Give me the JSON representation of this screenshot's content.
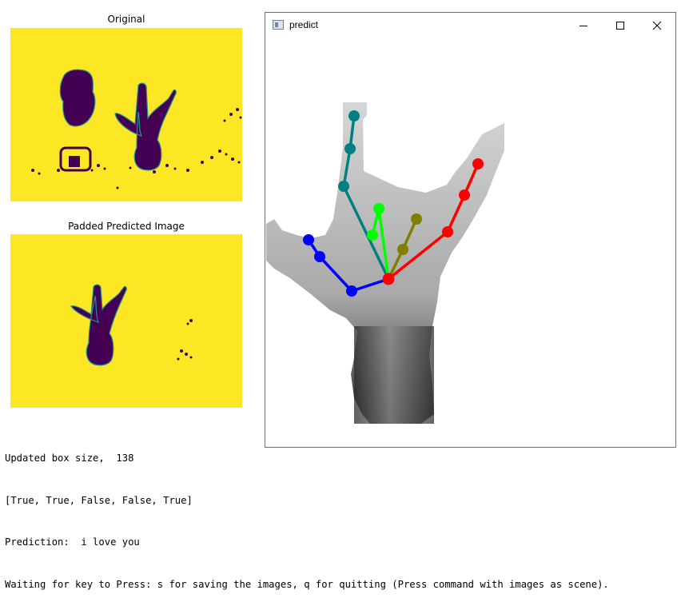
{
  "panels": {
    "original_title": "Original",
    "padded_title": "Padded Predicted Image"
  },
  "console": {
    "line1": "Updated box size,  138",
    "line2": "[True, True, False, False, True]",
    "line3": "Prediction:  i love you",
    "line4": "Waiting for key to Press: s for saving the images, q for quitting (Press command with images as scene)."
  },
  "window": {
    "title": "predict",
    "icons": [
      "app-icon",
      "minimize-icon",
      "maximize-icon",
      "close-icon"
    ]
  },
  "colors": {
    "yellow": "#fde725",
    "purple": "#440154",
    "teal": "#21918c",
    "thumb": "#0000ff",
    "index": "#00ff00",
    "middle": "#808000",
    "ring": "#008080",
    "pinky": "#ff0000"
  }
}
